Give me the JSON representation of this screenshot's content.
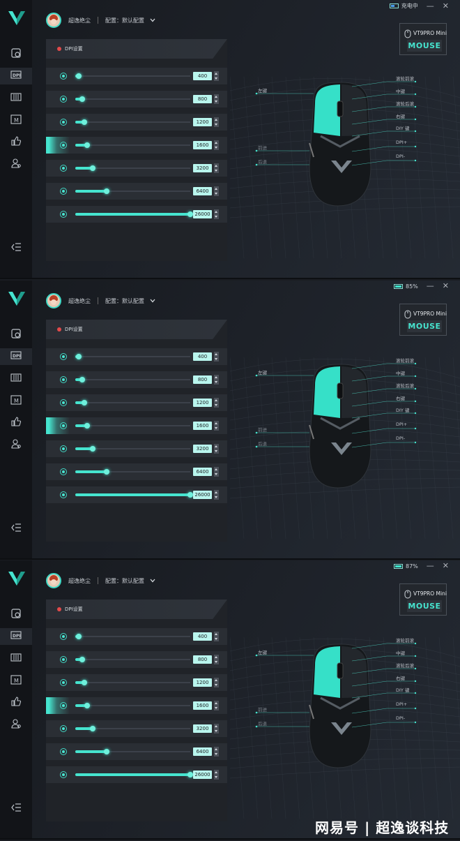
{
  "panels": [
    {
      "user_name": "超逸绝尘",
      "profile_label": "配置：默认配置",
      "status_text": "充电中",
      "battery_state": "charging",
      "section_title": "DPI设置",
      "active_row": 3,
      "dpi_levels": [
        {
          "value": "400",
          "fraction": 0.03
        },
        {
          "value": "800",
          "fraction": 0.06
        },
        {
          "value": "1200",
          "fraction": 0.08
        },
        {
          "value": "1600",
          "fraction": 0.1
        },
        {
          "value": "3200",
          "fraction": 0.15
        },
        {
          "value": "6400",
          "fraction": 0.27
        },
        {
          "value": "26000",
          "fraction": 1.0
        }
      ]
    },
    {
      "user_name": "超逸绝尘",
      "profile_label": "配置：默认配置",
      "status_text": "85%",
      "battery_state": "full",
      "section_title": "DPI设置",
      "active_row": 3,
      "dpi_levels": [
        {
          "value": "400",
          "fraction": 0.03
        },
        {
          "value": "800",
          "fraction": 0.06
        },
        {
          "value": "1200",
          "fraction": 0.08
        },
        {
          "value": "1600",
          "fraction": 0.1
        },
        {
          "value": "3200",
          "fraction": 0.15
        },
        {
          "value": "6400",
          "fraction": 0.27
        },
        {
          "value": "26000",
          "fraction": 1.0
        }
      ]
    },
    {
      "user_name": "超逸绝尘",
      "profile_label": "配置：默认配置",
      "status_text": "87%",
      "battery_state": "full",
      "section_title": "DPI设置",
      "active_row": 3,
      "dpi_levels": [
        {
          "value": "400",
          "fraction": 0.03
        },
        {
          "value": "800",
          "fraction": 0.06
        },
        {
          "value": "1200",
          "fraction": 0.08
        },
        {
          "value": "1600",
          "fraction": 0.1
        },
        {
          "value": "3200",
          "fraction": 0.15
        },
        {
          "value": "6400",
          "fraction": 0.27
        },
        {
          "value": "26000",
          "fraction": 1.0
        }
      ]
    }
  ],
  "device": {
    "model": "VT9PRO Mini",
    "type_word": "MOUSE"
  },
  "mouse_labels": {
    "left": [
      "左键",
      "前进",
      "后退"
    ],
    "right": [
      "滚轮前滚",
      "中键",
      "滚轮后滚",
      "右键",
      "DIY 键",
      "DPI+",
      "DPI-"
    ]
  },
  "nav_icons": [
    "macro-icon",
    "dpi-icon",
    "eq-icon",
    "mode-icon",
    "like-icon",
    "user-icon"
  ],
  "watermark": "网易号 | 超逸谈科技",
  "colors": {
    "accent": "#46e4cf",
    "red_dot": "#e24a4a"
  }
}
